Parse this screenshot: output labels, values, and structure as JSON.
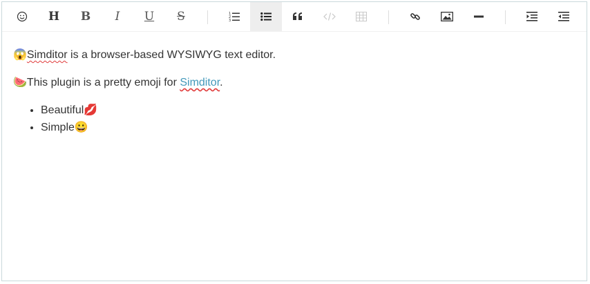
{
  "toolbar": {
    "buttons": [
      {
        "name": "emoji-button",
        "icon": "smiley-icon"
      },
      {
        "name": "title-button",
        "icon": "heading-icon",
        "glyph": "H"
      },
      {
        "name": "bold-button",
        "icon": "bold-icon",
        "glyph": "B"
      },
      {
        "name": "italic-button",
        "icon": "italic-icon",
        "glyph": "I"
      },
      {
        "name": "underline-button",
        "icon": "underline-icon",
        "glyph": "U"
      },
      {
        "name": "strikethrough-button",
        "icon": "strikethrough-icon",
        "glyph": "S"
      },
      {
        "name": "ordered-list-button",
        "icon": "ordered-list-icon"
      },
      {
        "name": "unordered-list-button",
        "icon": "unordered-list-icon",
        "active": true
      },
      {
        "name": "blockquote-button",
        "icon": "quote-icon"
      },
      {
        "name": "code-button",
        "icon": "code-icon",
        "disabled": true
      },
      {
        "name": "table-button",
        "icon": "table-icon",
        "disabled": true
      },
      {
        "name": "link-button",
        "icon": "link-icon"
      },
      {
        "name": "image-button",
        "icon": "image-icon"
      },
      {
        "name": "horizontal-rule-button",
        "icon": "hr-icon"
      },
      {
        "name": "indent-button",
        "icon": "indent-icon"
      },
      {
        "name": "outdent-button",
        "icon": "outdent-icon"
      }
    ],
    "colors": {
      "icon": "#333333",
      "disabled": "#c8c8c8",
      "active_bg": "#eeeeee"
    }
  },
  "content": {
    "p1": {
      "emoji": "😱",
      "link_word": "Simditor",
      "rest": " is a browser-based WYSIWYG text editor."
    },
    "p2": {
      "emoji": "🍉",
      "text": "This plugin is a pretty emoji for ",
      "link": "Simditor",
      "end": "."
    },
    "list": [
      {
        "text": "Beautiful",
        "emoji": "💋"
      },
      {
        "text": "Simple",
        "emoji": "😀"
      }
    ],
    "link_color": "#4298ba"
  }
}
